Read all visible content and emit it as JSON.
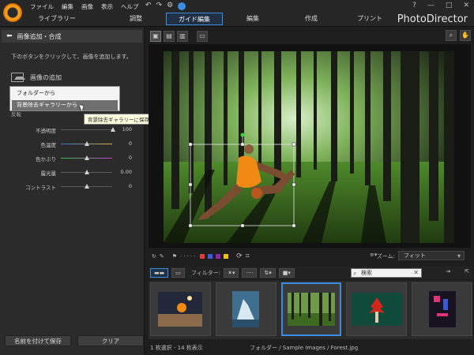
{
  "app": {
    "brand": "PhotoDirector",
    "menu": [
      "ファイル",
      "編集",
      "画像",
      "表示",
      "ヘルプ"
    ],
    "tabs": [
      "ライブラリー",
      "調整",
      "ガイド編集",
      "編集",
      "作成",
      "プリント"
    ],
    "active_tab": "ガイド編集",
    "window_controls": [
      "?",
      "—",
      "□",
      "✕"
    ]
  },
  "left_panel": {
    "title": "画像追加・合成",
    "hint": "下のボタンをクリックして、画像を追加します。",
    "add_image": "画像の追加",
    "mini_label": "反転",
    "dropdown": {
      "items": [
        "フォルダーから",
        "背景除去ギャラリーから"
      ],
      "selected": "背景除去ギャラリーから"
    },
    "tooltip": "背景除去ギャラリーに保存される画像を使う",
    "sliders": [
      {
        "label": "不透明度",
        "value": "100"
      },
      {
        "label": "色温度",
        "value": "0"
      },
      {
        "label": "色かぶり",
        "value": "0"
      },
      {
        "label": "露光量",
        "value": "0.00"
      },
      {
        "label": "コントラスト",
        "value": "0"
      }
    ],
    "buttons": {
      "save_as": "名前を付けて保存",
      "clear": "クリア"
    }
  },
  "center": {
    "zoom_label": "ズーム:",
    "zoom_value": "フィット",
    "swatches": [
      "#e53935",
      "#3b5bdb",
      "#8e24aa",
      "#f2c200"
    ]
  },
  "gallery_bar": {
    "filter_label": "フィルター:",
    "search_placeholder": "検索"
  },
  "thumbnails": [
    {
      "name": "basketball-arena",
      "selected": false
    },
    {
      "name": "iceberg",
      "selected": false
    },
    {
      "name": "forest",
      "selected": true
    },
    {
      "name": "red-leaf",
      "selected": false
    },
    {
      "name": "neon-night",
      "selected": false
    }
  ],
  "status": {
    "count": "1 枚選択 - 14 枚表示",
    "path": "フォルダー / Sample Images / Forest.jpg"
  }
}
